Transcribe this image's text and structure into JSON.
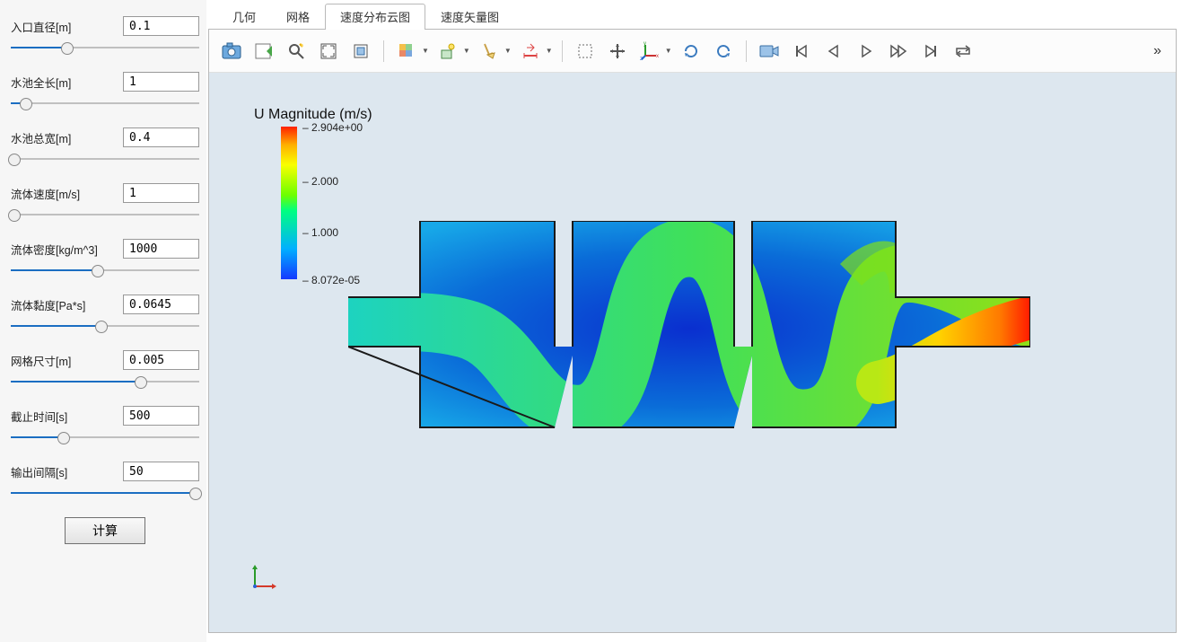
{
  "params": [
    {
      "id": "inlet-diameter",
      "label": "入口直径[m]",
      "value": "0.1",
      "pos": 30
    },
    {
      "id": "pool-length",
      "label": "水池全长[m]",
      "value": "1",
      "pos": 8
    },
    {
      "id": "pool-width",
      "label": "水池总宽[m]",
      "value": "0.4",
      "pos": 2
    },
    {
      "id": "fluid-velocity",
      "label": "流体速度[m/s]",
      "value": "1",
      "pos": 2
    },
    {
      "id": "fluid-density",
      "label": "流体密度[kg/m^3]",
      "value": "1000",
      "pos": 46
    },
    {
      "id": "fluid-viscosity",
      "label": "流体黏度[Pa*s]",
      "value": "0.0645",
      "pos": 48
    },
    {
      "id": "mesh-size",
      "label": "网格尺寸[m]",
      "value": "0.005",
      "pos": 69
    },
    {
      "id": "end-time",
      "label": "截止时间[s]",
      "value": "500",
      "pos": 28
    },
    {
      "id": "output-interval",
      "label": "输出间隔[s]",
      "value": "50",
      "pos": 98
    }
  ],
  "calc_button": "计算",
  "tabs": [
    {
      "id": "geometry",
      "label": "几何"
    },
    {
      "id": "mesh",
      "label": "网格"
    },
    {
      "id": "velocity-map",
      "label": "速度分布云图"
    },
    {
      "id": "vector-plot",
      "label": "速度矢量图"
    }
  ],
  "active_tab_index": 2,
  "toolbar": {
    "camera": "screenshot-icon",
    "save": "save-icon",
    "zoom": "zoom-icon",
    "fit": "fit-view-icon",
    "fit3d": "fit-box-icon",
    "coloring": "color-mode-icon",
    "vis": "visibility-icon",
    "sweep": "sweep-icon",
    "ruler": "ruler-icon",
    "select": "box-select-icon",
    "pan": "pan-icon",
    "axes": "axes-gizmo-icon",
    "rotcw": "rotate-cw-icon",
    "rotccw": "rotate-ccw-icon",
    "camrec": "camera-record-icon",
    "first": "first-frame-icon",
    "prev": "prev-frame-icon",
    "play": "play-icon",
    "next": "next-frame-icon",
    "last": "last-frame-icon",
    "loop": "loop-icon",
    "overflow": "»"
  },
  "legend": {
    "title": "U Magnitude (m/s)",
    "ticks": [
      {
        "label": "2.904e+00",
        "pct": 0
      },
      {
        "label": "2.000",
        "pct": 35
      },
      {
        "label": "1.000",
        "pct": 69
      },
      {
        "label": "8.072e-05",
        "pct": 100
      }
    ]
  },
  "chart_data": {
    "type": "heatmap",
    "title": "U Magnitude (m/s)",
    "xlabel": "",
    "ylabel": "",
    "colormap": "rainbow",
    "value_range_min": 8.072e-05,
    "value_range_max": 2.904,
    "geometry": "serpentine-baffled-tank",
    "chambers": 3,
    "inlet_side": "left",
    "outlet_side": "right",
    "notes": "CFD velocity magnitude contour in a 3-chamber baffled flow channel; inlet channel on left (≈1 m/s green), flow meanders over/under baffles, accelerates near outlet to ≈2.9 m/s (red)."
  }
}
